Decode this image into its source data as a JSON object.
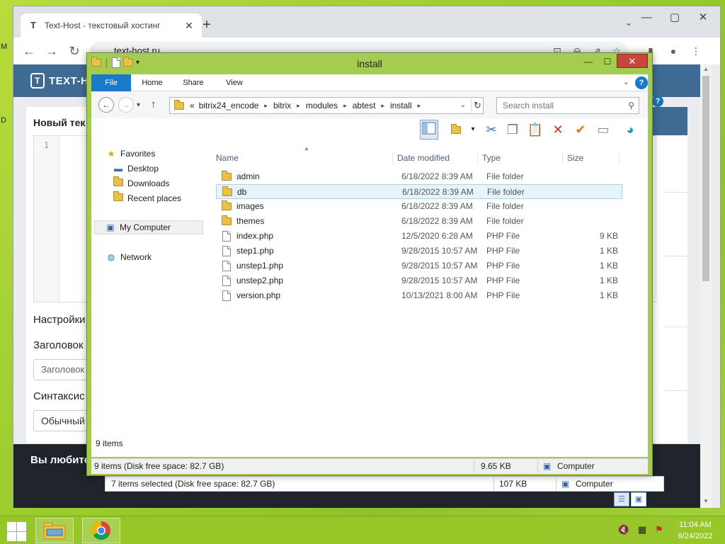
{
  "desktop": {
    "fragments": [
      "M",
      "D"
    ]
  },
  "browser": {
    "tab_title": "Text-Host - текстовый хостинг",
    "tab_favicon": "T",
    "new_tab": "+",
    "tab_dropdown": "⌄",
    "minimize": "—",
    "maximize": "▢",
    "close": "✕",
    "back": "←",
    "forward": "→",
    "reload": "↻",
    "url": "text-host.ru",
    "site": {
      "logo_mark": "T",
      "logo_text": "TEXT-HOST",
      "help": "?",
      "page_heading": "Новый тек",
      "line_number": "1",
      "settings_label": "Настройки",
      "title_label": "Заголовок",
      "title_placeholder": "Заголовок",
      "syntax_label": "Синтаксис",
      "syntax_value": "Обычный",
      "footer_text": "Вы любите"
    }
  },
  "explorer_behind": {
    "status_selected": "7 items selected (Disk free space: 82.7 GB)",
    "status_size": "107 KB",
    "status_location": "Computer"
  },
  "explorer": {
    "title": "install",
    "qat_dropdown": "▾",
    "minimize": "—",
    "maximize": "☐",
    "close": "✕",
    "ribbon_tabs": [
      "File",
      "Home",
      "Share",
      "View"
    ],
    "ribbon_help": "?",
    "ribbon_expand": "⌄",
    "back": "←",
    "forward": "→",
    "recent_dropdown": "▾",
    "up": "↑",
    "address": {
      "overflow": "«",
      "segments": [
        "bitrix24_encode",
        "bitrix",
        "modules",
        "abtest",
        "install"
      ],
      "separator": "▸"
    },
    "address_dropdown": "⌄",
    "refresh": "↻",
    "search_placeholder": "Search install",
    "nav": {
      "favorites": "Favorites",
      "desktop": "Desktop",
      "downloads": "Downloads",
      "recent_places": "Recent places",
      "my_computer": "My Computer",
      "network": "Network"
    },
    "columns": {
      "name": "Name",
      "date": "Date modified",
      "type": "Type",
      "size": "Size"
    },
    "sort_indicator": "▲",
    "files": [
      {
        "name": "admin",
        "date": "6/18/2022 8:39 AM",
        "type": "File folder",
        "size": "",
        "kind": "folder"
      },
      {
        "name": "db",
        "date": "6/18/2022 8:39 AM",
        "type": "File folder",
        "size": "",
        "kind": "folder"
      },
      {
        "name": "images",
        "date": "6/18/2022 8:39 AM",
        "type": "File folder",
        "size": "",
        "kind": "folder"
      },
      {
        "name": "themes",
        "date": "6/18/2022 8:39 AM",
        "type": "File folder",
        "size": "",
        "kind": "folder"
      },
      {
        "name": "index.php",
        "date": "12/5/2020 6:28 AM",
        "type": "PHP File",
        "size": "9 KB",
        "kind": "file"
      },
      {
        "name": "step1.php",
        "date": "9/28/2015 10:57 AM",
        "type": "PHP File",
        "size": "1 KB",
        "kind": "file"
      },
      {
        "name": "unstep1.php",
        "date": "9/28/2015 10:57 AM",
        "type": "PHP File",
        "size": "1 KB",
        "kind": "file"
      },
      {
        "name": "unstep2.php",
        "date": "9/28/2015 10:57 AM",
        "type": "PHP File",
        "size": "1 KB",
        "kind": "file"
      },
      {
        "name": "version.php",
        "date": "10/13/2021 8:00 AM",
        "type": "PHP File",
        "size": "1 KB",
        "kind": "file"
      }
    ],
    "selected_file": "db",
    "item_count": "9 items",
    "status_items": "9 items (Disk free space: 82.7 GB)",
    "status_size": "9.65 KB",
    "status_location": "Computer"
  },
  "taskbar": {
    "time": "11:04 AM",
    "date": "9/24/2022"
  },
  "colors": {
    "accent": "#1979ca",
    "window_frame": "#a4cc4e",
    "close_button": "#c7463b",
    "selection": "#e5f3fb"
  },
  "icons": {
    "tray": [
      "speaker-muted-icon",
      "network-icon",
      "action-center-icon"
    ]
  }
}
